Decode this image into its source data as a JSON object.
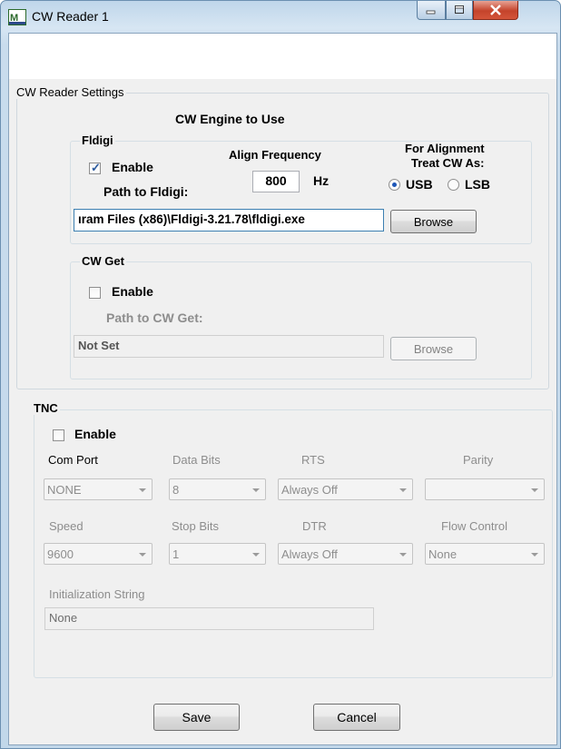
{
  "window": {
    "title": "CW Reader 1"
  },
  "settings": {
    "group_title": "CW Reader Settings",
    "engine_heading": "CW Engine to Use",
    "fldigi": {
      "title": "Fldigi",
      "enable_label": "Enable",
      "enabled": true,
      "align_freq_label": "Align Frequency",
      "align_freq_value": "800",
      "hz_label": "Hz",
      "path_label": "Path to Fldigi:",
      "alignment_label_1": "For Alignment",
      "alignment_label_2": "Treat CW As:",
      "usb_label": "USB",
      "lsb_label": "LSB",
      "selected_mode": "USB",
      "path_value": "ıram Files (x86)\\Fldigi-3.21.78\\fldigi.exe",
      "browse_label": "Browse"
    },
    "cwget": {
      "title": "CW Get",
      "enable_label": "Enable",
      "enabled": false,
      "path_label": "Path to CW Get:",
      "path_value": "Not Set",
      "browse_label": "Browse"
    }
  },
  "tnc": {
    "title": "TNC",
    "enable_label": "Enable",
    "enabled": false,
    "com_port_label": "Com Port",
    "com_port_value": "NONE",
    "data_bits_label": "Data Bits",
    "data_bits_value": "8",
    "rts_label": "RTS",
    "rts_value": "Always Off",
    "parity_label": "Parity",
    "parity_value": "",
    "speed_label": "Speed",
    "speed_value": "9600",
    "stop_bits_label": "Stop Bits",
    "stop_bits_value": "1",
    "dtr_label": "DTR",
    "dtr_value": "Always Off",
    "flow_control_label": "Flow Control",
    "flow_control_value": "None",
    "init_string_label": "Initialization String",
    "init_string_value": "None"
  },
  "footer": {
    "save_label": "Save",
    "cancel_label": "Cancel"
  }
}
